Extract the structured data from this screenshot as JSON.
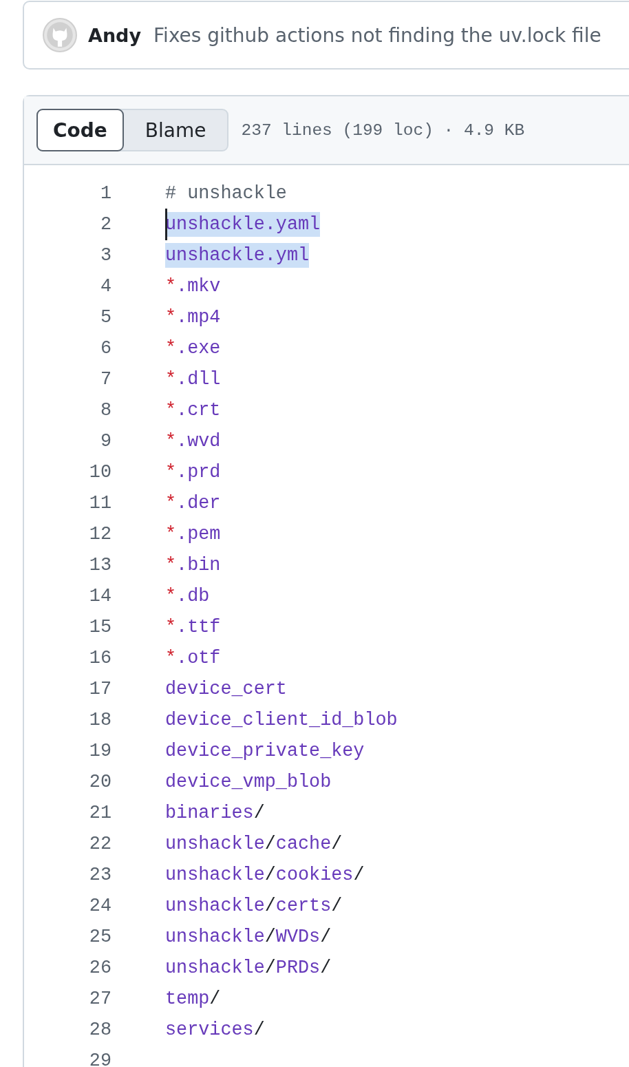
{
  "commit": {
    "author": "Andy",
    "message": "Fixes github actions not finding the uv.lock file"
  },
  "file": {
    "views": [
      {
        "label": "Code",
        "selected": true
      },
      {
        "label": "Blame",
        "selected": false
      }
    ],
    "meta": "237 lines (199 loc) · 4.9 KB"
  },
  "lines": [
    {
      "number": "1",
      "selected": false,
      "cursor": false,
      "tokens": [
        {
          "kind": "comment",
          "text": "# unshackle"
        }
      ]
    },
    {
      "number": "2",
      "selected": true,
      "cursor": true,
      "tokens": [
        {
          "kind": "path",
          "text": "unshackle.yaml"
        }
      ]
    },
    {
      "number": "3",
      "selected": true,
      "cursor": false,
      "tokens": [
        {
          "kind": "path",
          "text": "unshackle.yml"
        }
      ]
    },
    {
      "number": "4",
      "selected": false,
      "cursor": false,
      "tokens": [
        {
          "kind": "glob",
          "text": "*"
        },
        {
          "kind": "path",
          "text": ".mkv"
        }
      ]
    },
    {
      "number": "5",
      "selected": false,
      "cursor": false,
      "tokens": [
        {
          "kind": "glob",
          "text": "*"
        },
        {
          "kind": "path",
          "text": ".mp4"
        }
      ]
    },
    {
      "number": "6",
      "selected": false,
      "cursor": false,
      "tokens": [
        {
          "kind": "glob",
          "text": "*"
        },
        {
          "kind": "path",
          "text": ".exe"
        }
      ]
    },
    {
      "number": "7",
      "selected": false,
      "cursor": false,
      "tokens": [
        {
          "kind": "glob",
          "text": "*"
        },
        {
          "kind": "path",
          "text": ".dll"
        }
      ]
    },
    {
      "number": "8",
      "selected": false,
      "cursor": false,
      "tokens": [
        {
          "kind": "glob",
          "text": "*"
        },
        {
          "kind": "path",
          "text": ".crt"
        }
      ]
    },
    {
      "number": "9",
      "selected": false,
      "cursor": false,
      "tokens": [
        {
          "kind": "glob",
          "text": "*"
        },
        {
          "kind": "path",
          "text": ".wvd"
        }
      ]
    },
    {
      "number": "10",
      "selected": false,
      "cursor": false,
      "tokens": [
        {
          "kind": "glob",
          "text": "*"
        },
        {
          "kind": "path",
          "text": ".prd"
        }
      ]
    },
    {
      "number": "11",
      "selected": false,
      "cursor": false,
      "tokens": [
        {
          "kind": "glob",
          "text": "*"
        },
        {
          "kind": "path",
          "text": ".der"
        }
      ]
    },
    {
      "number": "12",
      "selected": false,
      "cursor": false,
      "tokens": [
        {
          "kind": "glob",
          "text": "*"
        },
        {
          "kind": "path",
          "text": ".pem"
        }
      ]
    },
    {
      "number": "13",
      "selected": false,
      "cursor": false,
      "tokens": [
        {
          "kind": "glob",
          "text": "*"
        },
        {
          "kind": "path",
          "text": ".bin"
        }
      ]
    },
    {
      "number": "14",
      "selected": false,
      "cursor": false,
      "tokens": [
        {
          "kind": "glob",
          "text": "*"
        },
        {
          "kind": "path",
          "text": ".db"
        }
      ]
    },
    {
      "number": "15",
      "selected": false,
      "cursor": false,
      "tokens": [
        {
          "kind": "glob",
          "text": "*"
        },
        {
          "kind": "path",
          "text": ".ttf"
        }
      ]
    },
    {
      "number": "16",
      "selected": false,
      "cursor": false,
      "tokens": [
        {
          "kind": "glob",
          "text": "*"
        },
        {
          "kind": "path",
          "text": ".otf"
        }
      ]
    },
    {
      "number": "17",
      "selected": false,
      "cursor": false,
      "tokens": [
        {
          "kind": "path",
          "text": "device_cert"
        }
      ]
    },
    {
      "number": "18",
      "selected": false,
      "cursor": false,
      "tokens": [
        {
          "kind": "path",
          "text": "device_client_id_blob"
        }
      ]
    },
    {
      "number": "19",
      "selected": false,
      "cursor": false,
      "tokens": [
        {
          "kind": "path",
          "text": "device_private_key"
        }
      ]
    },
    {
      "number": "20",
      "selected": false,
      "cursor": false,
      "tokens": [
        {
          "kind": "path",
          "text": "device_vmp_blob"
        }
      ]
    },
    {
      "number": "21",
      "selected": false,
      "cursor": false,
      "tokens": [
        {
          "kind": "path",
          "text": "binaries"
        },
        {
          "kind": "sep",
          "text": "/"
        }
      ]
    },
    {
      "number": "22",
      "selected": false,
      "cursor": false,
      "tokens": [
        {
          "kind": "path",
          "text": "unshackle"
        },
        {
          "kind": "sep",
          "text": "/"
        },
        {
          "kind": "path",
          "text": "cache"
        },
        {
          "kind": "sep",
          "text": "/"
        }
      ]
    },
    {
      "number": "23",
      "selected": false,
      "cursor": false,
      "tokens": [
        {
          "kind": "path",
          "text": "unshackle"
        },
        {
          "kind": "sep",
          "text": "/"
        },
        {
          "kind": "path",
          "text": "cookies"
        },
        {
          "kind": "sep",
          "text": "/"
        }
      ]
    },
    {
      "number": "24",
      "selected": false,
      "cursor": false,
      "tokens": [
        {
          "kind": "path",
          "text": "unshackle"
        },
        {
          "kind": "sep",
          "text": "/"
        },
        {
          "kind": "path",
          "text": "certs"
        },
        {
          "kind": "sep",
          "text": "/"
        }
      ]
    },
    {
      "number": "25",
      "selected": false,
      "cursor": false,
      "tokens": [
        {
          "kind": "path",
          "text": "unshackle"
        },
        {
          "kind": "sep",
          "text": "/"
        },
        {
          "kind": "path",
          "text": "WVDs"
        },
        {
          "kind": "sep",
          "text": "/"
        }
      ]
    },
    {
      "number": "26",
      "selected": false,
      "cursor": false,
      "tokens": [
        {
          "kind": "path",
          "text": "unshackle"
        },
        {
          "kind": "sep",
          "text": "/"
        },
        {
          "kind": "path",
          "text": "PRDs"
        },
        {
          "kind": "sep",
          "text": "/"
        }
      ]
    },
    {
      "number": "27",
      "selected": false,
      "cursor": false,
      "tokens": [
        {
          "kind": "path",
          "text": "temp"
        },
        {
          "kind": "sep",
          "text": "/"
        }
      ]
    },
    {
      "number": "28",
      "selected": false,
      "cursor": false,
      "tokens": [
        {
          "kind": "path",
          "text": "services"
        },
        {
          "kind": "sep",
          "text": "/"
        }
      ]
    },
    {
      "number": "29"
    }
  ]
}
